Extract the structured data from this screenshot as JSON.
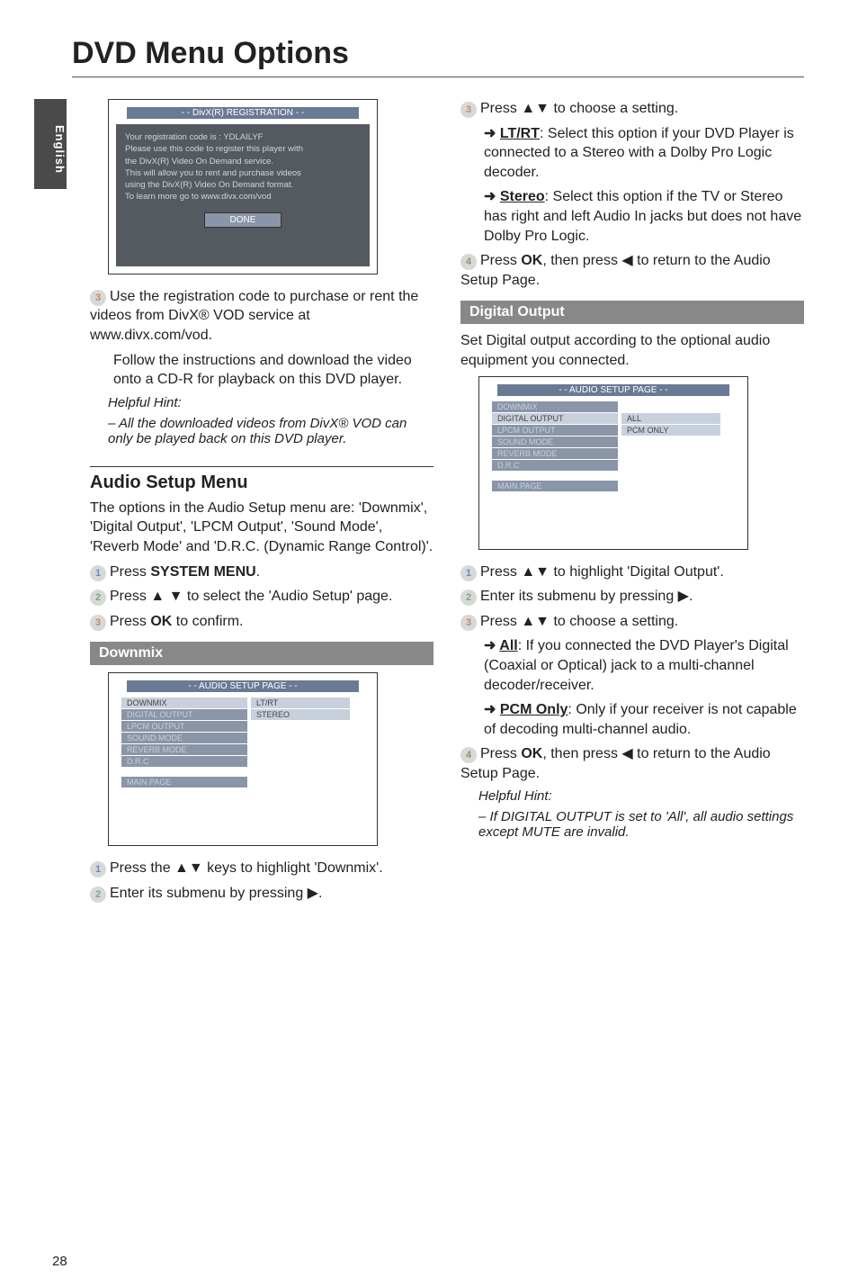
{
  "side_tab": "English",
  "page_title": "DVD Menu Options",
  "page_number": "28",
  "left": {
    "reg_box": {
      "title": "- - DivX(R) REGISTRATION - -",
      "line1": "Your registration code is : YDLAILYF",
      "line2": "Please use this code to register this player with",
      "line3": "the DivX(R) Video On Demand service.",
      "line4": "This will allow you to rent and purchase videos",
      "line5": "using the DivX(R) Video On Demand format.",
      "line6": "To learn more go to www.divx.com/vod",
      "done": "DONE"
    },
    "step3a": "Use the registration code to purchase or rent the videos from DivX® VOD service at www.divx.com/vod.",
    "step3b": "Follow the instructions and download the video onto a CD-R for playback on this DVD player.",
    "hint_label": "Helpful Hint:",
    "hint_body": "–   All the downloaded videos from DivX® VOD can only be played back on this DVD player.",
    "audio_setup_heading": "Audio Setup Menu",
    "audio_setup_intro": "The options in the Audio Setup menu are: 'Downmix', 'Digital Output', 'LPCM Output', 'Sound Mode', 'Reverb Mode' and 'D.R.C. (Dynamic Range Control)'.",
    "step1": "Press SYSTEM MENU.",
    "step2": "Press ▲ ▼ to select the 'Audio Setup' page.",
    "step3c": "Press OK to confirm.",
    "downmix_heading": "Downmix",
    "downmix_box": {
      "title": "- - AUDIO SETUP PAGE - -",
      "left_items": [
        "DOWNMIX",
        "DIGITAL OUTPUT",
        "LPCM OUTPUT",
        "SOUND MODE",
        "REVERB MODE",
        "D.R.C"
      ],
      "main_page": "MAIN PAGE",
      "right_items": [
        "LT/RT",
        "STEREO"
      ]
    },
    "foot1": "Press the ▲▼ keys to highlight 'Downmix'.",
    "foot2": "Enter its submenu by pressing ▶."
  },
  "right": {
    "r3a": "Press ▲▼ to choose a setting.",
    "r3_lt": "LT/RT",
    "r3_lt_body": ": Select this option if your DVD Player is connected to a Stereo with a Dolby Pro Logic decoder.",
    "r3_stereo": "Stereo",
    "r3_stereo_body": ": Select this option if the TV or Stereo has right and left Audio In jacks but does not have Dolby Pro Logic.",
    "r4": "Press OK, then press ◀ to return to the Audio Setup Page.",
    "digital_heading": "Digital Output",
    "digital_intro": "Set Digital output according to the optional audio equipment you connected.",
    "digital_box": {
      "title": "- - AUDIO SETUP PAGE - -",
      "left_items": [
        "DOWNMIX",
        "DIGITAL OUTPUT",
        "LPCM OUTPUT",
        "SOUND MODE",
        "REVERB MODE",
        "D.R.C"
      ],
      "main_page": "MAIN PAGE",
      "right_items": [
        "ALL",
        "PCM ONLY"
      ]
    },
    "d1": "Press ▲▼ to highlight 'Digital Output'.",
    "d2": "Enter its submenu by pressing ▶.",
    "d3a": "Press ▲▼ to choose a setting.",
    "d3_all": "All",
    "d3_all_body": ": If you connected the DVD Player's Digital (Coaxial or Optical) jack to a multi-channel decoder/receiver.",
    "d3_pcm": "PCM Only",
    "d3_pcm_body": ": Only if your receiver is not capable of decoding multi-channel audio.",
    "d4": "Press OK, then press ◀ to return to the Audio Setup Page.",
    "hint_label": "Helpful Hint:",
    "hint_body": "–   If DIGITAL OUTPUT is set to 'All', all audio settings except MUTE are invalid."
  }
}
